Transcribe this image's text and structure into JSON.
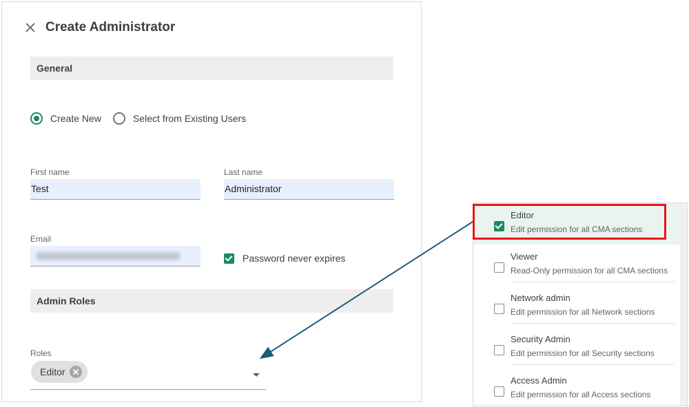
{
  "dialog": {
    "title": "Create Administrator",
    "general_section": "General",
    "admin_roles_section": "Admin Roles"
  },
  "user_source": {
    "options": [
      {
        "label": "Create New",
        "selected": true
      },
      {
        "label": "Select from Existing Users",
        "selected": false
      }
    ]
  },
  "form": {
    "first_name": {
      "label": "First name",
      "value": "Test"
    },
    "last_name": {
      "label": "Last name",
      "value": "Administrator"
    },
    "email": {
      "label": "Email"
    },
    "password_never_expires": {
      "label": "Password never expires",
      "checked": true
    },
    "roles": {
      "label": "Roles",
      "chips": [
        "Editor"
      ]
    }
  },
  "role_options": [
    {
      "name": "Editor",
      "description": "Edit permission for all CMA sections",
      "checked": true
    },
    {
      "name": "Viewer",
      "description": "Read-Only permission for all CMA sections",
      "checked": false
    },
    {
      "name": "Network admin",
      "description": "Edit permission for all Network sections",
      "checked": false
    },
    {
      "name": "Security Admin",
      "description": "Edit permission for all Security sections",
      "checked": false
    },
    {
      "name": "Access Admin",
      "description": "Edit permission for all Access sections",
      "checked": false
    }
  ],
  "colors": {
    "accent": "#1a8a5f",
    "highlight_border": "#e8141b",
    "arrow": "#1f5a7a",
    "selected_row": "#e9f4ef",
    "field_background": "#e8f0fe"
  },
  "icons": {
    "close": "close-icon",
    "chip_remove": "chip-remove-icon",
    "dropdown": "dropdown-arrow-icon"
  }
}
